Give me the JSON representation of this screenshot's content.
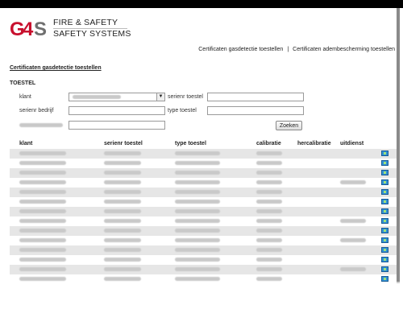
{
  "brand": {
    "line1": "FIRE & SAFETY",
    "line2": "SAFETY SYSTEMS",
    "colors": {
      "logo_red": "#c8102e",
      "logo_gray": "#6f6f6f"
    }
  },
  "topnav": {
    "link1": "Certificaten gasdetectie toestellen",
    "separator": "|",
    "link2": "Certificaten adembescherming toestellen"
  },
  "breadcrumb": "Certificaten gasdetectie toestellen",
  "form": {
    "section_title": "TOESTEL",
    "klant_label": "klant",
    "serienr_toestel_label": "serienr toestel",
    "serienr_bedrijf_label": "serienr bedrijf",
    "type_toestel_label": "type toestel",
    "search_button": "Zoeken"
  },
  "table": {
    "headers": [
      "klant",
      "serienr toestel",
      "type toestel",
      "calibratie",
      "hercalibratie",
      "uitdienst"
    ],
    "row_count": 14
  }
}
